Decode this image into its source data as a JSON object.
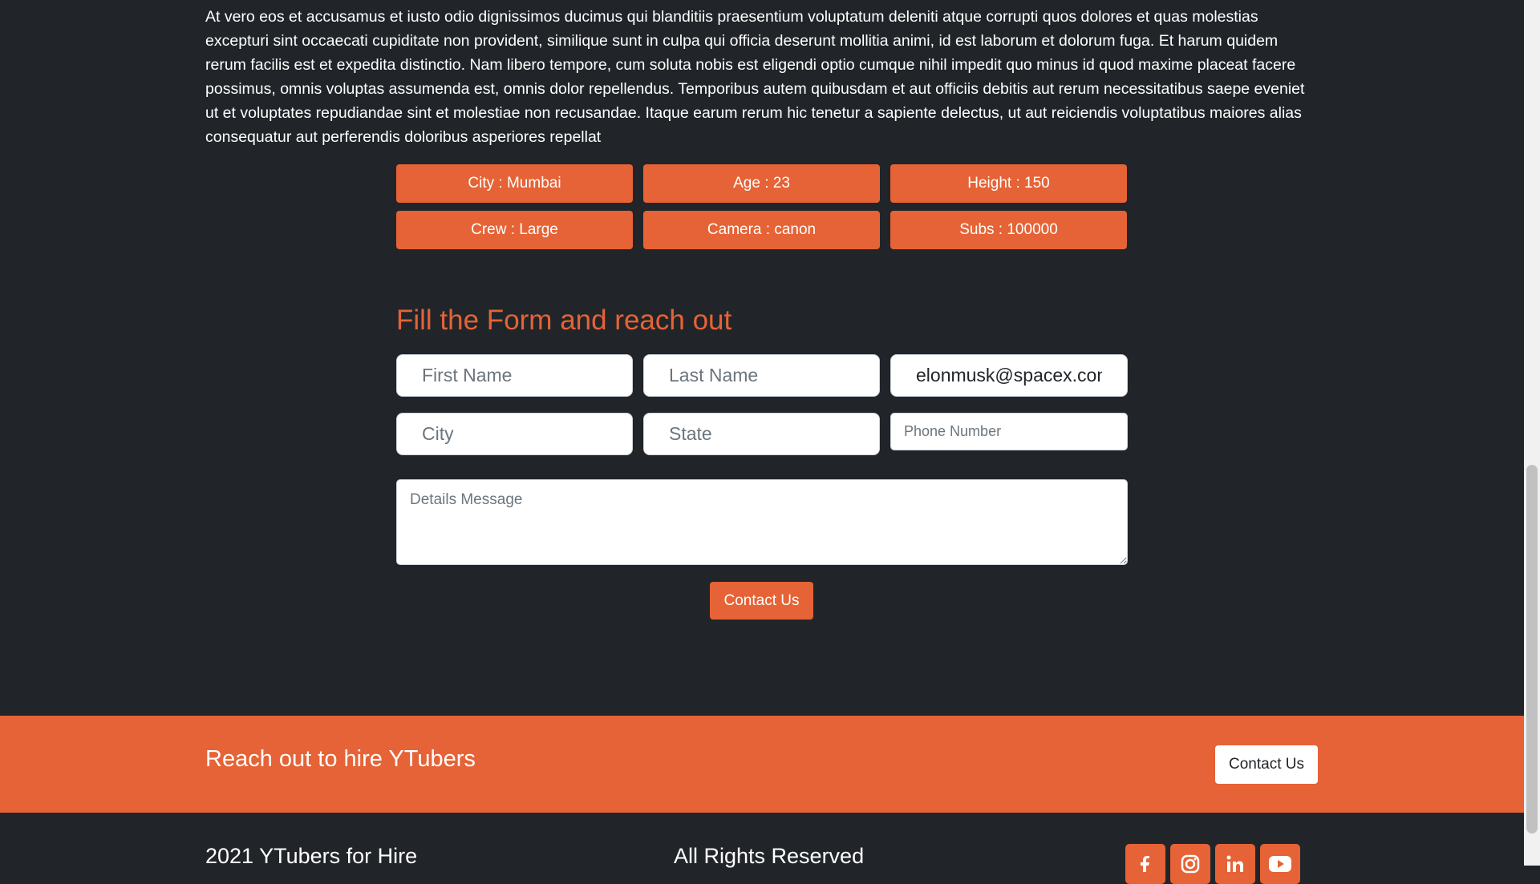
{
  "intro": {
    "paragraph": "At vero eos et accusamus et iusto odio dignissimos ducimus qui blanditiis praesentium voluptatum deleniti atque corrupti quos dolores et quas molestias excepturi sint occaecati cupiditate non provident, similique sunt in culpa qui officia deserunt mollitia animi, id est laborum et dolorum fuga. Et harum quidem rerum facilis est et expedita distinctio. Nam libero tempore, cum soluta nobis est eligendi optio cumque nihil impedit quo minus id quod maxime placeat facere possimus, omnis voluptas assumenda est, omnis dolor repellendus. Temporibus autem quibusdam et aut officiis debitis aut rerum necessitatibus saepe eveniet ut et voluptates repudiandae sint et molestiae non recusandae. Itaque earum rerum hic tenetur a sapiente delectus, ut aut reiciendis voluptatibus maiores alias consequatur aut perferendis doloribus asperiores repellat"
  },
  "stats": [
    "City : Mumbai",
    "Age : 23",
    "Height : 150",
    "Crew : Large",
    "Camera : canon",
    "Subs : 100000"
  ],
  "form": {
    "title": "Fill the Form and reach out",
    "first_name_placeholder": "First Name",
    "last_name_placeholder": "Last Name",
    "email_value": "elonmusk@spacex.com",
    "city_placeholder": "City",
    "state_placeholder": "State",
    "phone_placeholder": "Phone Number",
    "message_placeholder": "Details Message",
    "submit_label": "Contact Us"
  },
  "cta": {
    "heading": "Reach out to hire YTubers",
    "button_label": "Contact Us"
  },
  "footer": {
    "left": "2021 YTubers for Hire",
    "middle": "All Rights Reserved",
    "socials": [
      "facebook-icon",
      "instagram-icon",
      "linkedin-icon",
      "youtube-icon"
    ]
  },
  "colors": {
    "accent": "#e56336",
    "background": "#212529"
  }
}
